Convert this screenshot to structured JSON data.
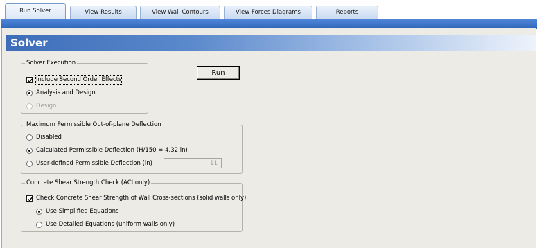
{
  "tabs": [
    {
      "label": "Run Solver"
    },
    {
      "label": "View Results"
    },
    {
      "label": "View Wall Contours"
    },
    {
      "label": "View Forces Diagrams"
    },
    {
      "label": "Reports"
    }
  ],
  "panel": {
    "title": "Solver"
  },
  "solver_execution": {
    "legend": "Solver Execution",
    "second_order_label": "Include Second Order Effects",
    "second_order_checked": true,
    "analysis_design_label": "Analysis and Design",
    "design_label": "Design",
    "selected": "Analysis and Design",
    "run_label": "Run"
  },
  "deflection": {
    "legend": "Maximum Permissible Out-of-plane Deflection",
    "disabled_label": "Disabled",
    "calculated_label": "Calculated Permissible Deflection (H/150 = 4.32 in)",
    "user_defined_label": "User-defined Permissible Deflection (in)",
    "user_defined_value": "11",
    "selected": "Calculated Permissible Deflection (H/150 = 4.32 in)"
  },
  "shear": {
    "legend": "Concrete Shear Strength Check (ACI only)",
    "check_label": "Check Concrete Shear Strength of Wall Cross-sections (solid walls only)",
    "check_checked": true,
    "simplified_label": "Use Simplified Equations",
    "detailed_label": "Use Detailed Equations (uniform walls only)",
    "selected": "Use Simplified Equations"
  }
}
